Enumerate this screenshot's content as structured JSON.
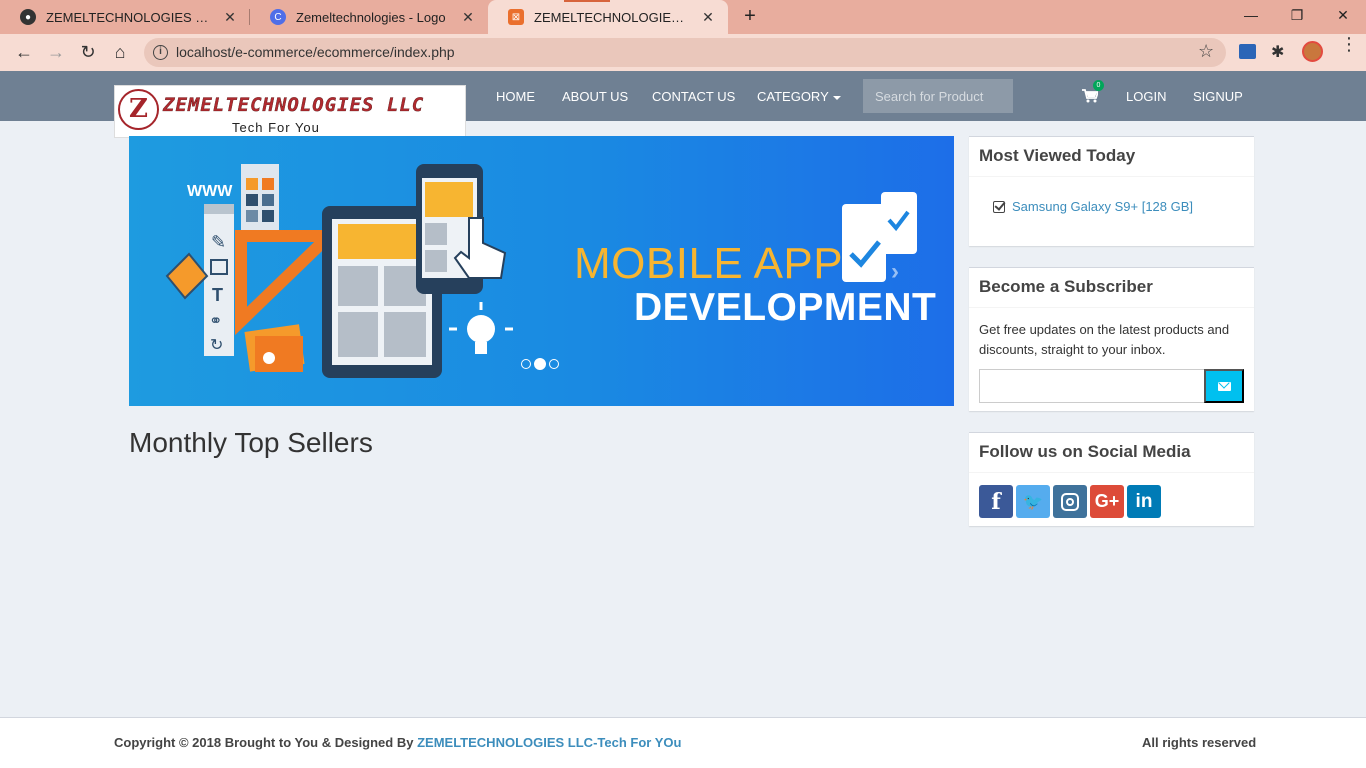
{
  "browser": {
    "tabs": [
      {
        "title": "ZEMELTECHNOLOGIES LLC-Tech For You",
        "favicon": "globe-icon"
      },
      {
        "title": "Zemeltechnologies - Logo",
        "favicon": "c-icon"
      },
      {
        "title": "ZEMELTECHNOLOGIES LLC SHOP",
        "favicon": "xampp-icon"
      }
    ],
    "address": "localhost/e-commerce/ecommerce/index.php"
  },
  "site": {
    "logo": {
      "title": "ZEMELTECHNOLOGIES LLC",
      "tagline": "Tech For You",
      "mark": "Z"
    },
    "nav": {
      "home": "HOME",
      "about": "ABOUT US",
      "contact": "CONTACT US",
      "category": "CATEGORY",
      "search_placeholder": "Search for Product",
      "cart_count": "0",
      "login": "LOGIN",
      "signup": "SIGNUP"
    },
    "carousel": {
      "line1": "MOBILE APP",
      "line2": "DEVELOPMENT",
      "active_slide": 2,
      "slide_count": 3
    },
    "main": {
      "section_title": "Monthly Top Sellers"
    },
    "sidebar": {
      "most_viewed": {
        "title": "Most Viewed Today",
        "items": [
          "Samsung Galaxy S9+ [128 GB]"
        ]
      },
      "subscribe": {
        "title": "Become a Subscriber",
        "text": "Get free updates on the latest products and discounts, straight to your inbox."
      },
      "social": {
        "title": "Follow us on Social Media",
        "networks": [
          "facebook",
          "twitter",
          "instagram",
          "google-plus",
          "linkedin"
        ]
      }
    },
    "footer": {
      "left_prefix": "Copyright © 2018 Brought to You & Designed By",
      "left_link": "ZEMELTECHNOLOGIES LLC-Tech For YOu",
      "right": "All rights reserved"
    }
  },
  "colors": {
    "navbar": "#6f8093",
    "accent_link": "#3c8dbc",
    "subscribe_button": "#00c0ef",
    "slide_title": "#f7b531"
  }
}
